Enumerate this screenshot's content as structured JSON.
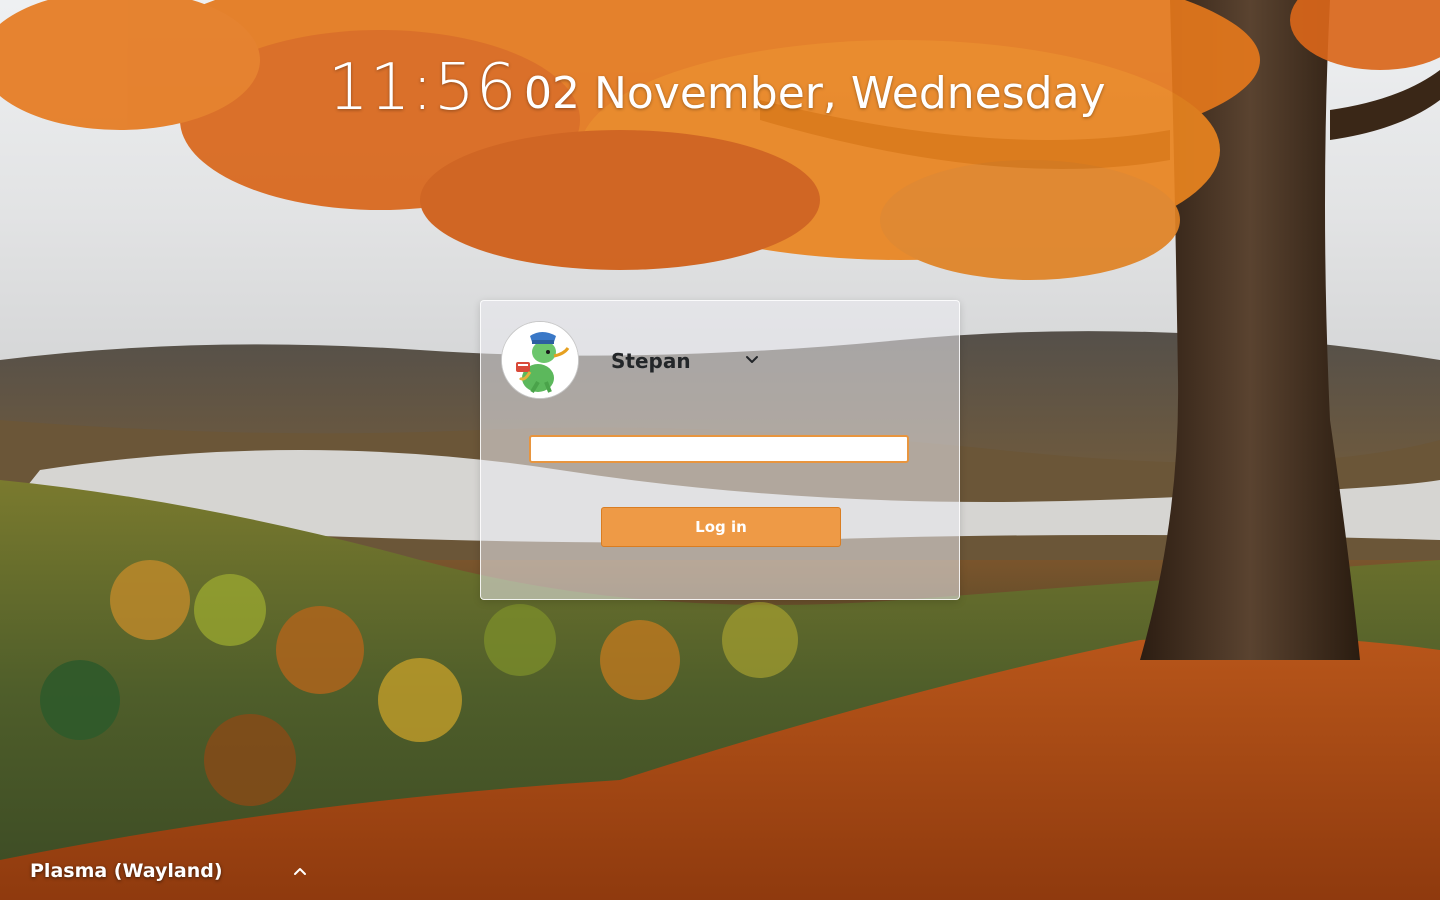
{
  "lockscreen": {
    "time": "11:56",
    "date": "02 November, Wednesday"
  },
  "login": {
    "username": "Stepan",
    "password_value": "",
    "login_button_label": "Log in"
  },
  "session": {
    "selected": "Plasma (Wayland)"
  },
  "icons": {
    "user_switch": "chevron-down-icon",
    "session_switch": "chevron-up-icon",
    "avatar": "konqi-dragon-avatar"
  },
  "colors": {
    "accent": "#ee9a46",
    "accent_border": "#e8953e",
    "foliage": "#d9661a",
    "text_dark": "#232629"
  }
}
